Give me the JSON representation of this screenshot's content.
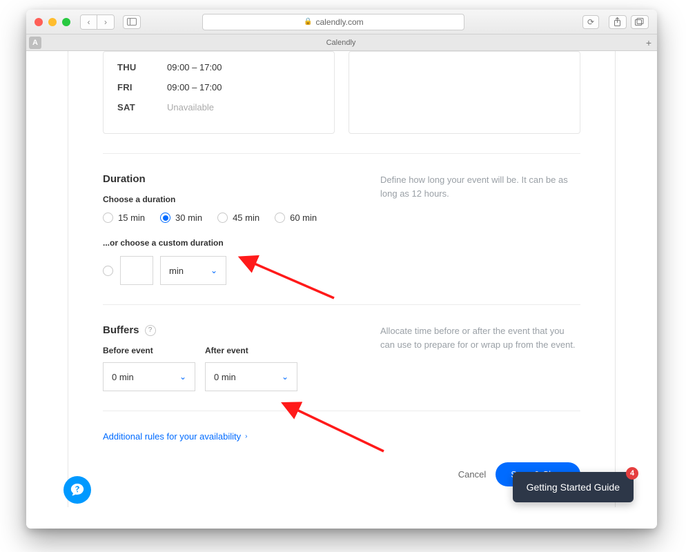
{
  "browser": {
    "url_host": "calendly.com",
    "tab_title": "Calendly",
    "pinned_label": "A"
  },
  "availability": {
    "days": [
      {
        "label": "THU",
        "time": "09:00 – 17:00",
        "available": true
      },
      {
        "label": "FRI",
        "time": "09:00 – 17:00",
        "available": true
      },
      {
        "label": "SAT",
        "time": "Unavailable",
        "available": false
      }
    ]
  },
  "duration": {
    "heading": "Duration",
    "description": "Define how long your event will be. It can be as long as 12 hours.",
    "choose_label": "Choose a duration",
    "options": [
      {
        "label": "15 min",
        "selected": false
      },
      {
        "label": "30 min",
        "selected": true
      },
      {
        "label": "45 min",
        "selected": false
      },
      {
        "label": "60 min",
        "selected": false
      }
    ],
    "custom_label": "...or choose a custom duration",
    "custom_value": "",
    "custom_unit": "min"
  },
  "buffers": {
    "heading": "Buffers",
    "description": "Allocate time before or after the event that you can use to prepare for or wrap up from the event.",
    "before_label": "Before event",
    "after_label": "After event",
    "before_value": "0 min",
    "after_value": "0 min"
  },
  "additional_link": "Additional rules for your availability",
  "footer": {
    "cancel": "Cancel",
    "save": "Save & Close"
  },
  "guide": {
    "label": "Getting Started Guide",
    "badge": "4"
  }
}
